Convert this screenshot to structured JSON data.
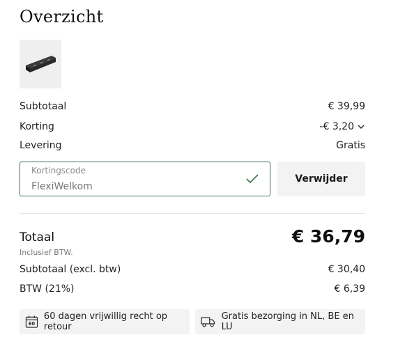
{
  "page_title": "Overzicht",
  "product": {
    "icon": "rail-bracket-thumbnail"
  },
  "summary": {
    "subtotal_label": "Subtotaal",
    "subtotal_value": "€ 39,99",
    "discount_label": "Korting",
    "discount_value": "-€ 3,20",
    "delivery_label": "Levering",
    "delivery_value": "Gratis"
  },
  "coupon": {
    "label": "Kortingscode",
    "value": "FlexiWelkom",
    "remove_label": "Verwijder"
  },
  "totals": {
    "total_label": "Totaal",
    "total_value": "€ 36,79",
    "vat_note": "Inclusief BTW.",
    "excl_label": "Subtotaal (excl. btw)",
    "excl_value": "€ 30,40",
    "vat_label": "BTW (21%)",
    "vat_value": "€ 6,39"
  },
  "badges": [
    {
      "icon": "calendar-60-icon",
      "label": "60 dagen vrijwillig recht op retour"
    },
    {
      "icon": "truck-icon",
      "label": "Gratis bezorging in NL, BE en LU"
    }
  ],
  "colors": {
    "accent_green": "#3f6d4f",
    "muted_bg": "#f3f3f3"
  }
}
